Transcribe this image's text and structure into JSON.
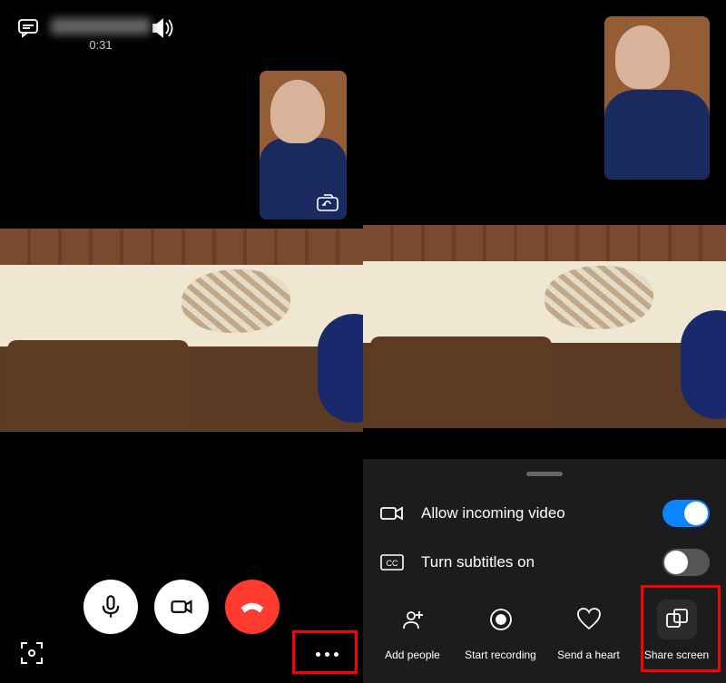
{
  "left_screen": {
    "call_duration": "0:31"
  },
  "right_screen": {
    "sheet": {
      "allow_video_label": "Allow incoming video",
      "subtitles_label": "Turn subtitles on"
    },
    "actions": {
      "add_people": "Add people",
      "start_recording": "Start recording",
      "send_heart": "Send a heart",
      "share_screen": "Share screen"
    }
  }
}
